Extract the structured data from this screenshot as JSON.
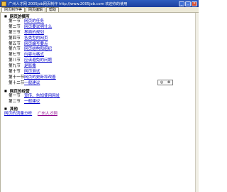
{
  "window": {
    "title": "广州人才网 2005job网页制作 http://www.2005job.com 欢迎你的使用",
    "minimize": "_",
    "maximize": "□",
    "close": "×"
  },
  "tabs": [
    "网页制作等",
    "网页编辑",
    "帮助"
  ],
  "sections": [
    {
      "heading": "网页的撰写",
      "items": [
        {
          "num": "第一节",
          "text": "网页的任务"
        },
        {
          "num": "第二节",
          "text": "网页要说明什么"
        },
        {
          "num": "第三节",
          "text": "界面的规划"
        },
        {
          "num": "第四节",
          "text": "各类型的网页"
        },
        {
          "num": "第五节",
          "text": "网页编写要点"
        },
        {
          "num": "第六节",
          "text": "网页结构和组织"
        },
        {
          "num": "第七节",
          "text": "内容与格式"
        },
        {
          "num": "第八节",
          "text": "应该避免的问题"
        },
        {
          "num": "第九节",
          "text": "是影像"
        },
        {
          "num": "第十节",
          "text": "网页测试"
        },
        {
          "num": "第十一节",
          "text": "网页的更新和改善"
        },
        {
          "num": "第十二节",
          "text": "一般建议"
        }
      ]
    },
    {
      "heading": "网页的经营",
      "items": [
        {
          "num": "第一节",
          "text": "宣传、告知使用网址"
        },
        {
          "num": "第二节",
          "text": "一般建议"
        }
      ]
    }
  ],
  "other": {
    "heading": "其他",
    "links": [
      "网页的流量分析",
      "广州人才网"
    ]
  },
  "popup": {
    "left": "◎",
    "right": "⊗"
  }
}
